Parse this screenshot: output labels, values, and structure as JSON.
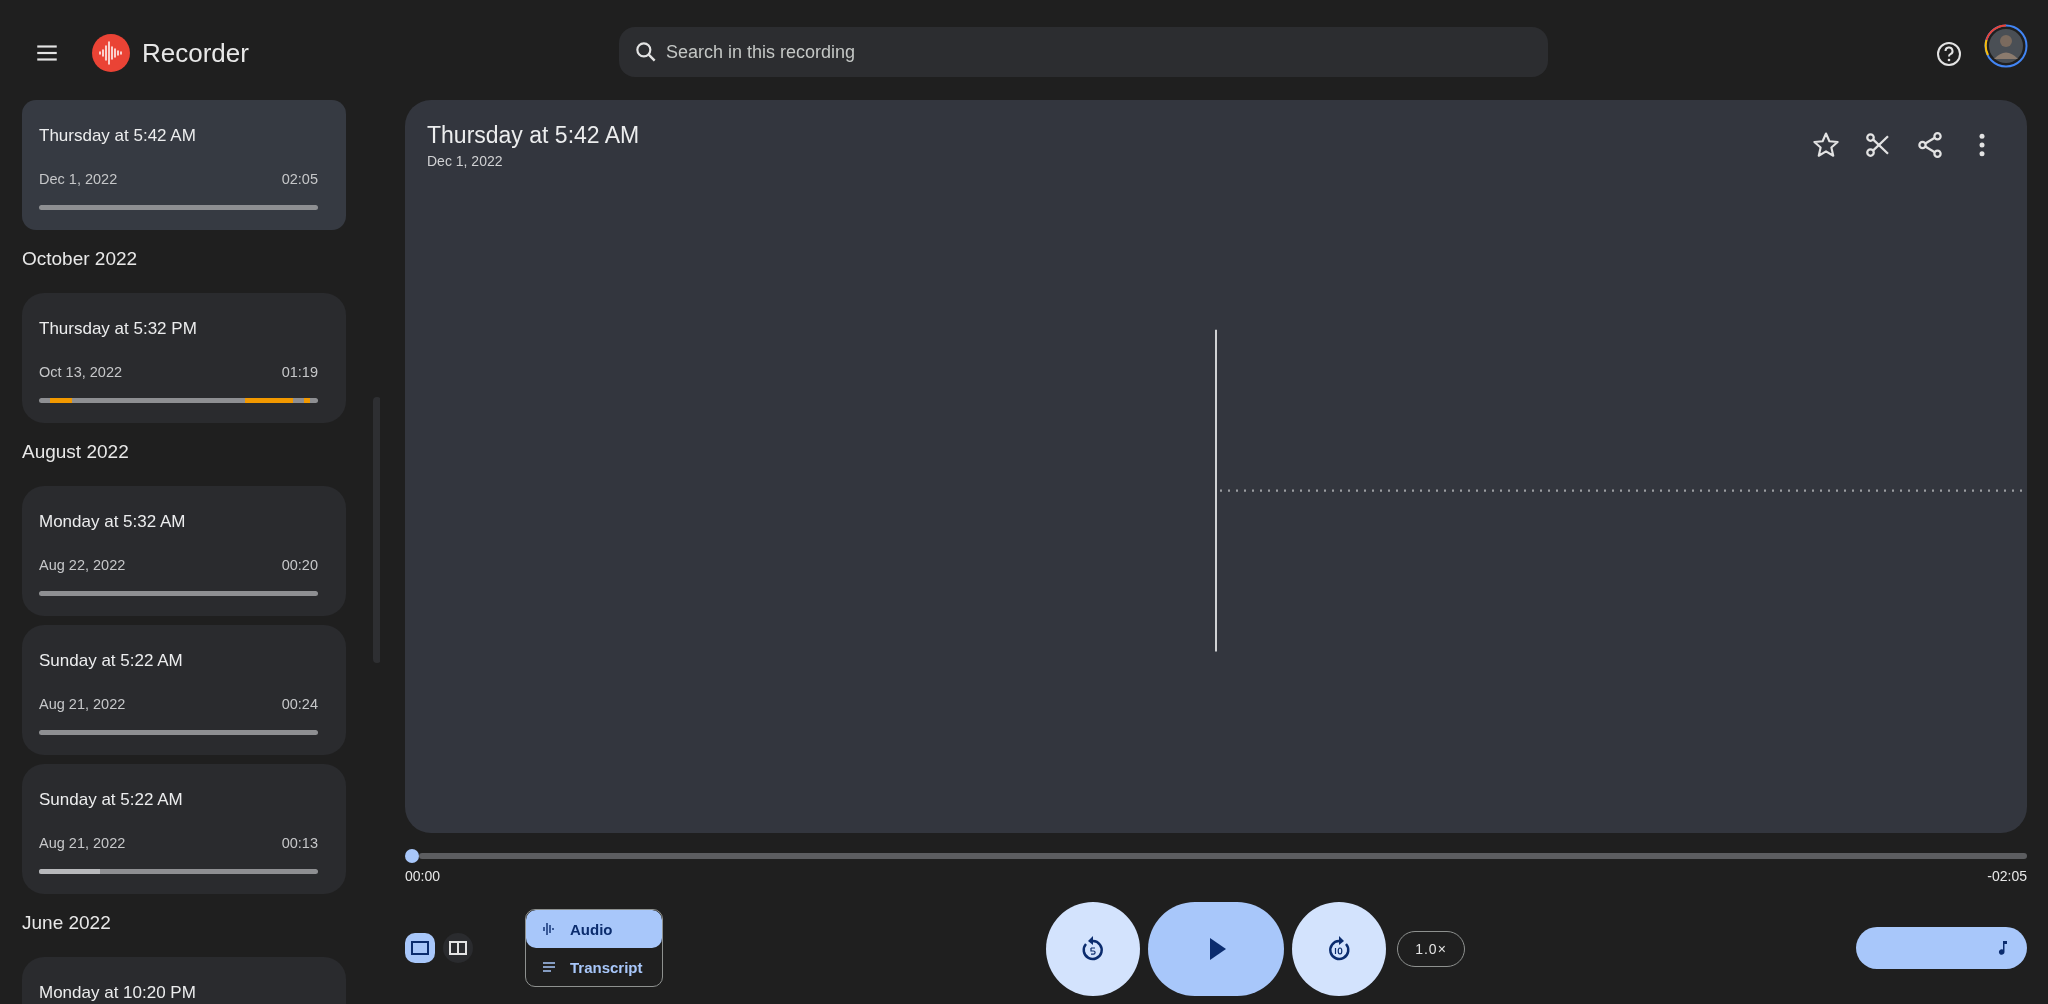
{
  "header": {
    "title": "Recorder",
    "search": {
      "placeholder": "Search in this recording"
    }
  },
  "sidebar": {
    "items": [
      {
        "kind": "recording",
        "title": "Thursday at 5:42 AM",
        "date": "Dec 1, 2022",
        "duration": "02:05",
        "selected": true,
        "highlighted": false
      },
      {
        "kind": "heading",
        "title": "October 2022"
      },
      {
        "kind": "recording",
        "title": "Thursday at 5:32 PM",
        "date": "Oct 13, 2022",
        "duration": "01:19",
        "selected": false,
        "highlighted": true
      },
      {
        "kind": "heading",
        "title": "August 2022"
      },
      {
        "kind": "recording",
        "title": "Monday at 5:32 AM",
        "date": "Aug 22, 2022",
        "duration": "00:20",
        "selected": false,
        "highlighted": false
      },
      {
        "kind": "recording",
        "title": "Sunday at 5:22 AM",
        "date": "Aug 21, 2022",
        "duration": "00:24",
        "selected": false,
        "highlighted": false
      },
      {
        "kind": "recording",
        "title": "Sunday at 5:22 AM",
        "date": "Aug 21, 2022",
        "duration": "00:13",
        "selected": false,
        "level": 0.22,
        "highlighted": false
      },
      {
        "kind": "heading",
        "title": "June 2022"
      },
      {
        "kind": "recording",
        "title": "Monday at 10:20 PM",
        "selected": false
      }
    ]
  },
  "recording": {
    "title": "Thursday at 5:42 AM",
    "date": "Dec 1, 2022"
  },
  "playback": {
    "level": 0,
    "elapsed": "00:00",
    "remaining": "-02:05",
    "speed": "1.0×"
  },
  "view_modes": [
    {
      "kind": "single",
      "selected": true
    },
    {
      "kind": "split",
      "selected": false
    }
  ],
  "tabs": [
    {
      "kind": "audio",
      "label": "Audio",
      "selected": true
    },
    {
      "kind": "transcript",
      "label": "Transcript",
      "selected": false
    }
  ]
}
